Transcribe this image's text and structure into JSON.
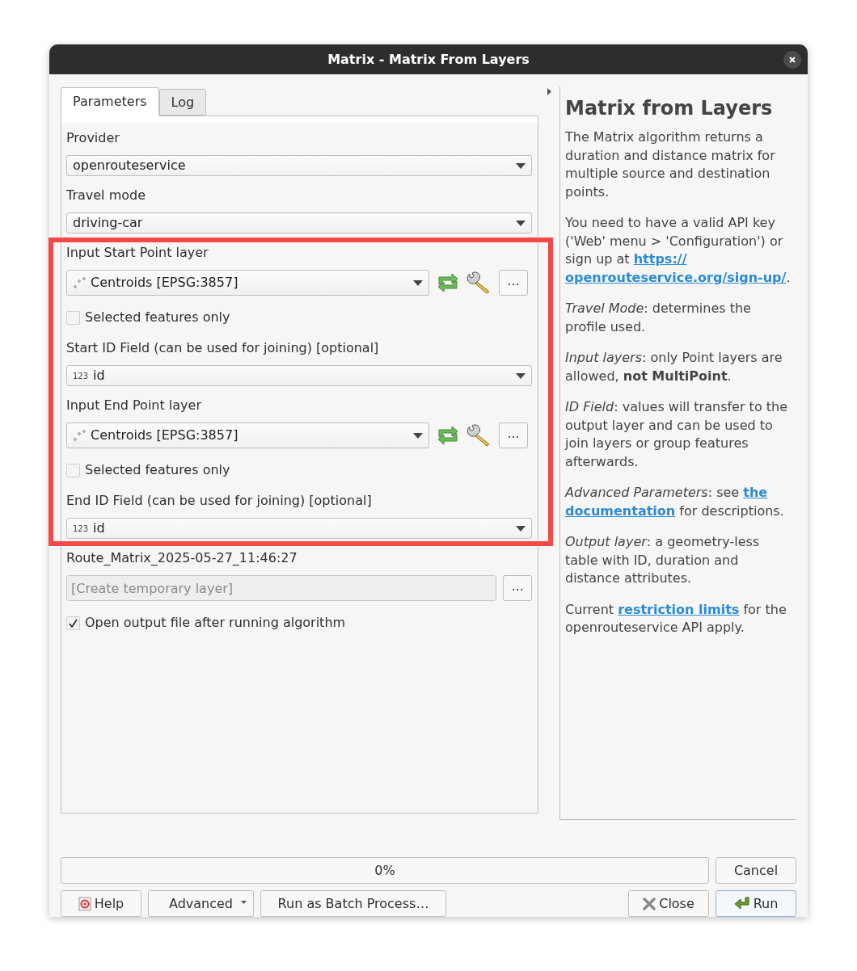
{
  "window": {
    "title": "Matrix - Matrix From Layers"
  },
  "tabs": [
    {
      "label": "Parameters",
      "selected": true
    },
    {
      "label": "Log",
      "selected": false
    }
  ],
  "parameters": [
    {
      "kind": "combo",
      "label": "Provider",
      "value": "openrouteservice"
    },
    {
      "kind": "combo",
      "label": "Travel mode",
      "value": "driving-car"
    },
    {
      "kind": "layer",
      "label": "Input Start Point layer",
      "value": "Centroids [EPSG:3857]",
      "browse": "…"
    },
    {
      "kind": "checkbox",
      "label": "Selected features only",
      "checked": false
    },
    {
      "kind": "field",
      "label": "Start ID Field (can be used for joining) [optional]",
      "type_badge": "123",
      "value": "id"
    },
    {
      "kind": "layer",
      "label": "Input End Point layer",
      "value": "Centroids [EPSG:3857]",
      "browse": "…"
    },
    {
      "kind": "checkbox",
      "label": "Selected features only",
      "checked": false
    },
    {
      "kind": "field",
      "label": "End ID Field (can be used for joining) [optional]",
      "type_badge": "123",
      "value": "id"
    },
    {
      "kind": "output",
      "label": "Route_Matrix_2025-05-27_11:46:27",
      "placeholder": "[Create temporary layer]",
      "browse": "…"
    },
    {
      "kind": "checkbox",
      "label": "Open output file after running algorithm",
      "checked": true
    }
  ],
  "help": {
    "title": "Matrix from Layers",
    "paragraphs": [
      [
        {
          "kind": "text",
          "text": "The Matrix algorithm returns a duration and distance matrix for multiple source and destination points."
        }
      ],
      [
        {
          "kind": "text",
          "text": "You need to have a valid API key ('Web' menu > 'Configuration') or sign up at "
        },
        {
          "kind": "link",
          "text": "https://"
        },
        {
          "kind": "link",
          "text": "openrouteservice.org/sign-up/"
        },
        {
          "kind": "text",
          "text": "."
        }
      ],
      [
        {
          "kind": "text",
          "text": "*Travel Mode*: determines the profile used."
        }
      ],
      [
        {
          "kind": "text",
          "text": "*Input layers*: only Point layers are allowed, **not MultiPoint**."
        }
      ],
      [
        {
          "kind": "text",
          "text": "*ID Field*: values will transfer to the output layer and can be used to join layers or group features afterwards."
        }
      ],
      [
        {
          "kind": "text",
          "text": "*Advanced Parameters*: see "
        },
        {
          "kind": "link",
          "text": "the"
        },
        {
          "kind": "link",
          "text": "documentation"
        },
        {
          "kind": "text",
          "text": " for descriptions."
        }
      ],
      [
        {
          "kind": "text",
          "text": "*Output layer*: a geometry-less table with ID, duration and distance attributes."
        }
      ],
      [
        {
          "kind": "text",
          "text": "Current "
        },
        {
          "kind": "link",
          "text": "restriction limits"
        },
        {
          "kind": "text",
          "text": " for the openrouteservice API apply."
        }
      ]
    ]
  },
  "progress": {
    "level": 0,
    "reading": "0%"
  },
  "cancel_button": "Cancel",
  "left_buttons": [
    {
      "kind": "help",
      "label": "Help"
    },
    {
      "kind": "menu",
      "label": "Advanced"
    },
    {
      "kind": "plain",
      "label": "Run as Batch Process…"
    }
  ],
  "right_buttons": [
    {
      "kind": "close",
      "label": "Close"
    },
    {
      "kind": "run",
      "label": "Run"
    }
  ]
}
